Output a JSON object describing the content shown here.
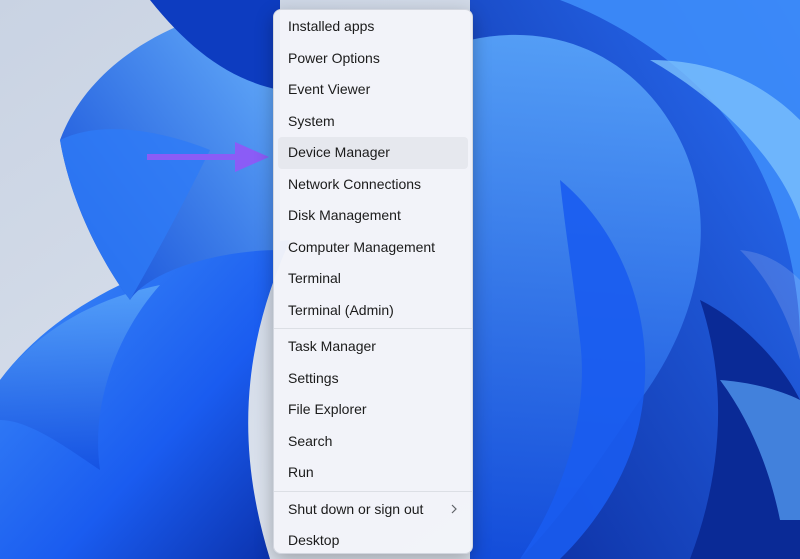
{
  "menu": {
    "groups": [
      {
        "items": [
          {
            "label": "Installed apps"
          },
          {
            "label": "Power Options"
          },
          {
            "label": "Event Viewer"
          },
          {
            "label": "System"
          },
          {
            "label": "Device Manager",
            "highlighted": true
          },
          {
            "label": "Network Connections"
          },
          {
            "label": "Disk Management"
          },
          {
            "label": "Computer Management"
          },
          {
            "label": "Terminal"
          },
          {
            "label": "Terminal (Admin)"
          }
        ]
      },
      {
        "items": [
          {
            "label": "Task Manager"
          },
          {
            "label": "Settings"
          },
          {
            "label": "File Explorer"
          },
          {
            "label": "Search"
          },
          {
            "label": "Run"
          }
        ]
      },
      {
        "items": [
          {
            "label": "Shut down or sign out",
            "icon": "chevron-right-icon"
          },
          {
            "label": "Desktop"
          }
        ]
      }
    ]
  },
  "annotation": {
    "pointer": "arrow-icon",
    "color": "#8b5cf6",
    "target": "Device Manager"
  },
  "colors": {
    "wallpaper_blue": "#1a5cf0",
    "wallpaper_deep": "#0a2fa8",
    "wallpaper_light": "#4a9af8"
  }
}
